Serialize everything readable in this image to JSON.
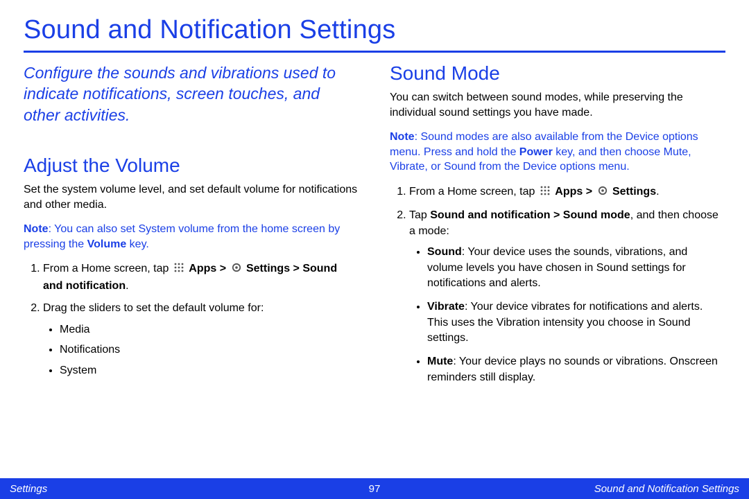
{
  "title": "Sound and Notification Settings",
  "intro": "Configure the sounds and vibrations used to indicate notifications, screen touches, and other activities.",
  "left": {
    "heading": "Adjust the Volume",
    "para": "Set the system volume level, and set default volume for notifications and other media.",
    "note_label": "Note",
    "note_1": ": You can also set System volume from the home screen by pressing the ",
    "note_kw": "Volume",
    "note_2": " key.",
    "step1_a": "From a Home screen, tap ",
    "step1_b": "Apps > ",
    "step1_c": "Settings > Sound and notification",
    "step1_d": ".",
    "step2": "Drag the sliders to set the default volume for:",
    "bullets": {
      "b1": "Media",
      "b2": "Notifications",
      "b3": "System"
    }
  },
  "right": {
    "heading": "Sound Mode",
    "para": "You can switch between sound modes, while preserving the individual sound settings you have made.",
    "note_label": "Note",
    "note_1": ": Sound modes are also available from the Device options menu. Press and hold the ",
    "note_kw": "Power",
    "note_2": " key, and then choose Mute, Vibrate, or Sound from the Device options menu.",
    "step1_a": "From a Home screen, tap ",
    "step1_b": "Apps > ",
    "step1_c": "Settings",
    "step1_d": ".",
    "step2_a": "Tap ",
    "step2_b": "Sound and notification > Sound mode",
    "step2_c": ", and then choose a mode:",
    "modes": {
      "m1_t": "Sound",
      "m1_d": ": Your device uses the sounds, vibrations, and volume levels you have chosen in Sound settings for notifications and alerts.",
      "m2_t": "Vibrate",
      "m2_d": ": Your device vibrates for notifications and alerts. This uses the Vibration intensity you choose in Sound settings.",
      "m3_t": "Mute",
      "m3_d": ": Your device plays no sounds or vibrations. Onscreen reminders still display."
    }
  },
  "footer": {
    "left": "Settings",
    "center": "97",
    "right": "Sound and Notification Settings"
  },
  "colors": {
    "accent": "#1a3fe6"
  }
}
